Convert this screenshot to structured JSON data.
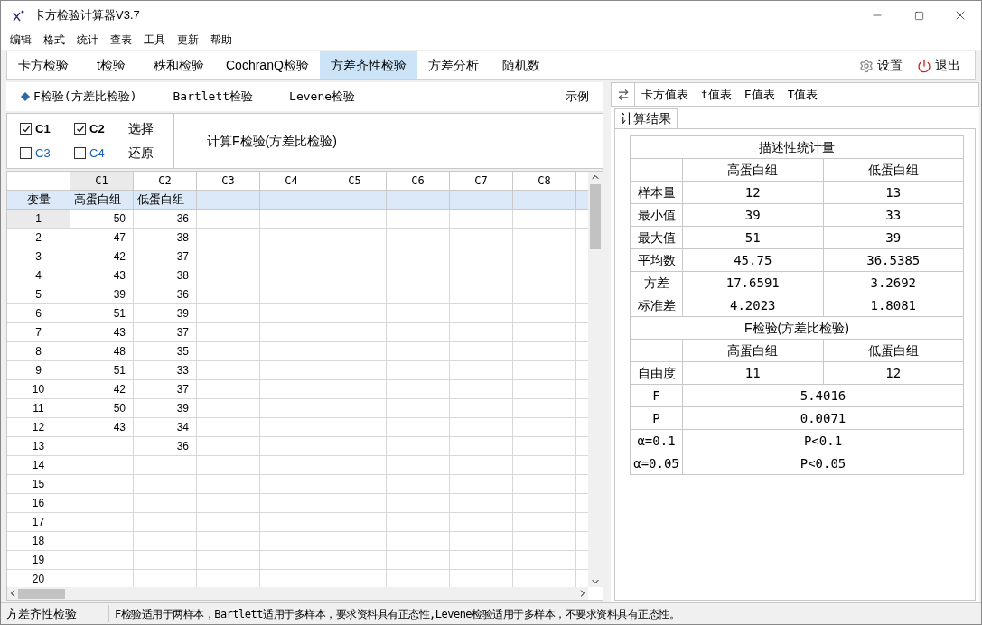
{
  "window": {
    "title": "卡方检验计算器V3.7"
  },
  "menu": [
    "编辑",
    "格式",
    "统计",
    "查表",
    "工具",
    "更新",
    "帮助"
  ],
  "tabs": [
    {
      "label": "卡方检验",
      "selected": false
    },
    {
      "label": "t检验",
      "selected": false
    },
    {
      "label": "秩和检验",
      "selected": false
    },
    {
      "label": "CochranQ检验",
      "selected": false
    },
    {
      "label": "方差齐性检验",
      "selected": true
    },
    {
      "label": "方差分析",
      "selected": false
    },
    {
      "label": "随机数",
      "selected": false
    }
  ],
  "settings_button": "设置",
  "exit_button": "退出",
  "subtabs": [
    {
      "label": "F检验(方差比检验)",
      "selected": true
    },
    {
      "label": "Bartlett检验",
      "selected": false
    },
    {
      "label": "Levene检验",
      "selected": false
    }
  ],
  "example_link": "示例",
  "columns_select": [
    {
      "label": "C1",
      "checked": true
    },
    {
      "label": "C2",
      "checked": true
    },
    {
      "label": "C3",
      "checked": false
    },
    {
      "label": "C4",
      "checked": false
    }
  ],
  "select_button": "选择",
  "restore_button": "还原",
  "compute_button": "计算F检验(方差比检验)",
  "grid": {
    "columns": [
      "C1",
      "C2",
      "C3",
      "C4",
      "C5",
      "C6",
      "C7",
      "C8"
    ],
    "variable_row": {
      "label": "变量",
      "names": [
        "高蛋白组",
        "低蛋白组"
      ]
    },
    "rows": [
      {
        "label": "1",
        "c1": "50",
        "c2": "36"
      },
      {
        "label": "2",
        "c1": "47",
        "c2": "38"
      },
      {
        "label": "3",
        "c1": "42",
        "c2": "37"
      },
      {
        "label": "4",
        "c1": "43",
        "c2": "38"
      },
      {
        "label": "5",
        "c1": "39",
        "c2": "36"
      },
      {
        "label": "6",
        "c1": "51",
        "c2": "39"
      },
      {
        "label": "7",
        "c1": "43",
        "c2": "37"
      },
      {
        "label": "8",
        "c1": "48",
        "c2": "35"
      },
      {
        "label": "9",
        "c1": "51",
        "c2": "33"
      },
      {
        "label": "10",
        "c1": "42",
        "c2": "37"
      },
      {
        "label": "11",
        "c1": "50",
        "c2": "39"
      },
      {
        "label": "12",
        "c1": "43",
        "c2": "34"
      },
      {
        "label": "13",
        "c2": "36"
      },
      {
        "label": "14"
      },
      {
        "label": "15"
      },
      {
        "label": "16"
      },
      {
        "label": "17"
      },
      {
        "label": "18"
      },
      {
        "label": "19"
      },
      {
        "label": "20"
      }
    ]
  },
  "table_tabs": [
    "卡方值表",
    "t值表",
    "F值表",
    "T值表"
  ],
  "result_tab": "计算结果",
  "results": [
    {
      "kind": "title",
      "text": "描述性统计量"
    },
    {
      "kind": "header",
      "cells": [
        "高蛋白组",
        "低蛋白组"
      ]
    },
    {
      "kind": "pair",
      "label": "样本量",
      "cells": [
        "12",
        "13"
      ]
    },
    {
      "kind": "pair",
      "label": "最小值",
      "cells": [
        "39",
        "33"
      ]
    },
    {
      "kind": "pair",
      "label": "最大值",
      "cells": [
        "51",
        "39"
      ]
    },
    {
      "kind": "pair",
      "label": "平均数",
      "cells": [
        "45.75",
        "36.5385"
      ]
    },
    {
      "kind": "pair",
      "label": "方差",
      "cells": [
        "17.6591",
        "3.2692"
      ]
    },
    {
      "kind": "pair",
      "label": "标准差",
      "cells": [
        "4.2023",
        "1.8081"
      ]
    },
    {
      "kind": "title",
      "text": "F检验(方差比检验)"
    },
    {
      "kind": "header",
      "cells": [
        "高蛋白组",
        "低蛋白组"
      ]
    },
    {
      "kind": "pair",
      "label": "自由度",
      "cells": [
        "11",
        "12"
      ]
    },
    {
      "kind": "single",
      "label": "F",
      "value": "5.4016"
    },
    {
      "kind": "single",
      "label": "P",
      "value": "0.0071"
    },
    {
      "kind": "single",
      "label": "α=0.1",
      "value": "P<0.1"
    },
    {
      "kind": "single",
      "label": "α=0.05",
      "value": "P<0.05"
    }
  ],
  "status_bar": {
    "section": "方差齐性检验",
    "message": "F检验适用于两样本，Bartlett适用于多样本，要求资料具有正态性,Levene检验适用于多样本，不要求资料具有正态性。"
  }
}
